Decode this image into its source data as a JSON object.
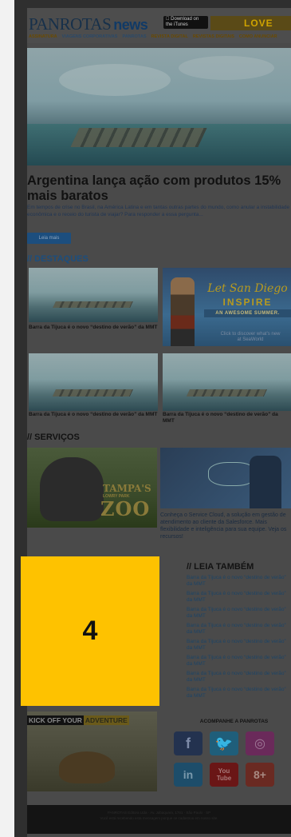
{
  "header": {
    "logo_main": "PANROTAS",
    "logo_news": "news",
    "appstore": "Download on the iTunes",
    "love_banner": "LOVE"
  },
  "nav": {
    "items": [
      "ASSINATURA",
      "VIAGENS CORPORATIVAS",
      "PANROTAS",
      "REVISTA DIGITAL",
      "REVISTAS DIGITAIS",
      "COMO ANUNCIAR"
    ]
  },
  "hero": {
    "headline": "Argentina lança ação com produtos 15% mais baratos",
    "summary": "Em tempos de crise no Brasil, na América Latina e em tantas outras partes do mundo, como anular a instabilidade econômica e o receio do turista de viajar? Para responder a essa pergunta...",
    "read_more": "Leia mais"
  },
  "destaques": {
    "title": "// DESTAQUES",
    "items": [
      {
        "caption": "Barra da Tijuca é o novo “destino de verão” da MMT"
      },
      {
        "caption": "Barra da Tijuca é o novo “destino de verão” da MMT"
      },
      {
        "caption": "Barra da Tijuca é o novo “destino de verão” da MMT"
      }
    ],
    "ad": {
      "line1": "Let San Diego",
      "line2": "INSPIRE",
      "line3": "AN AWESOME SUMMER.",
      "line4": "Click to discover what's new at SeaWorld"
    }
  },
  "servicos": {
    "title": "// SERVIÇOS",
    "zoo": {
      "line1": "TAMPA'S",
      "line2": "LOWRY PARK",
      "line3": "ZOO"
    },
    "cloud_desc": "Conheça o Service Cloud, a solução em gestão de atendimento ao cliente da Salesforce. Mais flexibilidade e inteligência para sua equipe. Veja os recursos!"
  },
  "overlay": {
    "label": "4"
  },
  "leia_tambem": {
    "title": "// LEIA TAMBÉM",
    "items": [
      "Barra da Tijuca é o novo “destino de verão” da MMT",
      "Barra da Tijuca é o novo “destino de verão” da MMT",
      "Barra da Tijuca é o novo “destino de verão” da MMT",
      "Barra da Tijuca é o novo “destino de verão” da MMT",
      "Barra da Tijuca é o novo “destino de verão” da MMT",
      "Barra da Tijuca é o novo “destino de verão” da MMT",
      "Barra da Tijuca é o novo “destino de verão” da MMT",
      "Barra da Tijuca é o novo “destino de verão” da MMT"
    ]
  },
  "kickoff": {
    "kick": "KICK OFF YOUR",
    "adventure": "ADVENTURE"
  },
  "social": {
    "title": "ACOMPANHE A PANROTAS",
    "facebook": "f",
    "twitter": "🐦",
    "instagram": "◎",
    "linkedin": "in",
    "youtube_top": "You",
    "youtube_bottom": "Tube",
    "googleplus": "8+"
  },
  "footer": {
    "line1": "PANROTAS Editora Ltda · Av. Jabaquara, 1761 · São Paulo · SP",
    "line2": "Você está recebendo esta mensagem porque se cadastrou em nosso site."
  }
}
